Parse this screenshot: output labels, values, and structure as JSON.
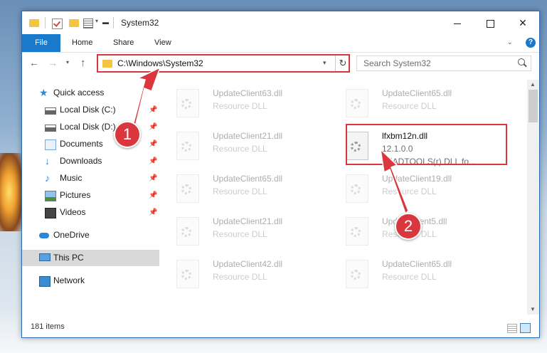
{
  "window": {
    "title": "System32",
    "controls": {
      "minimize": "",
      "maximize": "",
      "close": "✕"
    }
  },
  "ribbon": {
    "tabs": [
      "File",
      "Home",
      "Share",
      "View"
    ],
    "help": "?"
  },
  "navbar": {
    "address": "C:\\Windows\\System32",
    "search_placeholder": "Search System32"
  },
  "sidebar": {
    "items": [
      {
        "label": "Quick access",
        "icon": "star-icon"
      },
      {
        "label": "Local Disk (C:)",
        "icon": "drive-icon",
        "pinned": true
      },
      {
        "label": "Local Disk (D:)",
        "icon": "drive-icon",
        "pinned": true
      },
      {
        "label": "Documents",
        "icon": "documents-icon",
        "pinned": true
      },
      {
        "label": "Downloads",
        "icon": "download-icon",
        "pinned": true
      },
      {
        "label": "Music",
        "icon": "music-icon",
        "pinned": true
      },
      {
        "label": "Pictures",
        "icon": "pictures-icon",
        "pinned": true
      },
      {
        "label": "Videos",
        "icon": "videos-icon",
        "pinned": true
      },
      {
        "label": "OneDrive",
        "icon": "cloud-icon"
      },
      {
        "label": "This PC",
        "icon": "computer-icon"
      },
      {
        "label": "Network",
        "icon": "network-icon"
      }
    ]
  },
  "files": [
    {
      "name": "UpdateClient63.dll",
      "desc": "Resource DLL"
    },
    {
      "name": "UpdateClient65.dll",
      "desc": "Resource DLL"
    },
    {
      "name": "UpdateClient21.dll",
      "desc": "Resource DLL"
    },
    {
      "name": "lfxbm12n.dll",
      "version": "12.1.0.0",
      "desc": "LEADTOOLS(r) DLL fo..."
    },
    {
      "name": "UpdateClient65.dll",
      "desc": "Resource DLL"
    },
    {
      "name": "UpdateClient19.dll",
      "desc": "Resource DLL"
    },
    {
      "name": "UpdateClient21.dll",
      "desc": "Resource DLL"
    },
    {
      "name": "UpdateClient5.dll",
      "desc": "Resource DLL"
    },
    {
      "name": "UpdateClient42.dll",
      "desc": "Resource DLL"
    },
    {
      "name": "UpdateClient65.dll",
      "desc": "Resource DLL"
    }
  ],
  "status": {
    "count": "181 items"
  },
  "annotations": {
    "step1": "1",
    "step2": "2",
    "color": "#d9363e"
  }
}
